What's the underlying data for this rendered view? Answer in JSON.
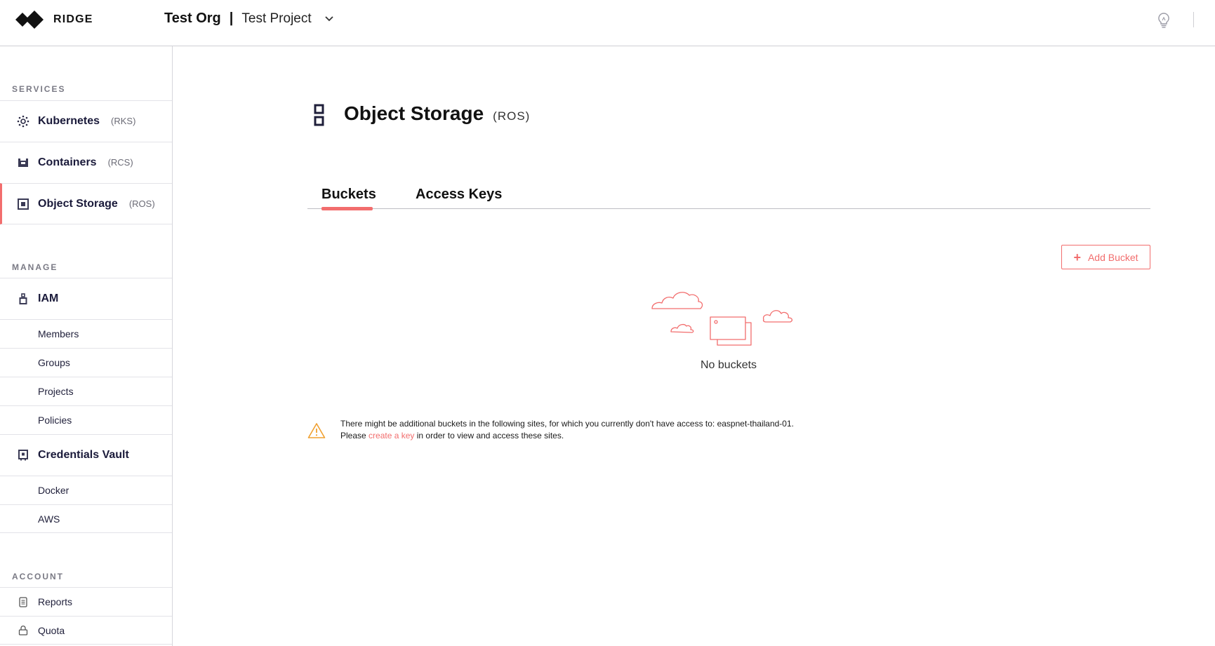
{
  "header": {
    "logo_text": "RIDGE",
    "org_name": "Test Org",
    "separator": "|",
    "project_name": "Test Project"
  },
  "sidebar": {
    "sections": {
      "services": "SERVICES",
      "manage": "MANAGE",
      "account": "ACCOUNT"
    },
    "services": [
      {
        "title": "Kubernetes",
        "sub": "(RKS)",
        "icon": "kubernetes-icon"
      },
      {
        "title": "Containers",
        "sub": "(RCS)",
        "icon": "containers-icon"
      },
      {
        "title": "Object Storage",
        "sub": "(ROS)",
        "icon": "object-storage-icon",
        "active": true
      }
    ],
    "manage": {
      "iam": "IAM",
      "iam_items": [
        "Members",
        "Groups",
        "Projects",
        "Policies"
      ],
      "vault": "Credentials Vault",
      "vault_items": [
        "Docker",
        "AWS"
      ]
    },
    "account": [
      "Reports",
      "Quota"
    ]
  },
  "page": {
    "title": "Object Storage",
    "subtitle": "(ROS)",
    "tabs": [
      "Buckets",
      "Access Keys"
    ],
    "active_tab": "Buckets",
    "add_button": "Add Bucket",
    "empty_text": "No buckets",
    "warning": {
      "line1": "There might be additional buckets in the following sites, for which you currently don't have access to: easpnet-thailand-01.",
      "prefix": "Please ",
      "link": "create a key",
      "suffix": " in order to view and access these sites."
    }
  },
  "colors": {
    "accent": "#f26d6d",
    "nav_text": "#1a1a3a",
    "border": "#d6d6dc"
  }
}
